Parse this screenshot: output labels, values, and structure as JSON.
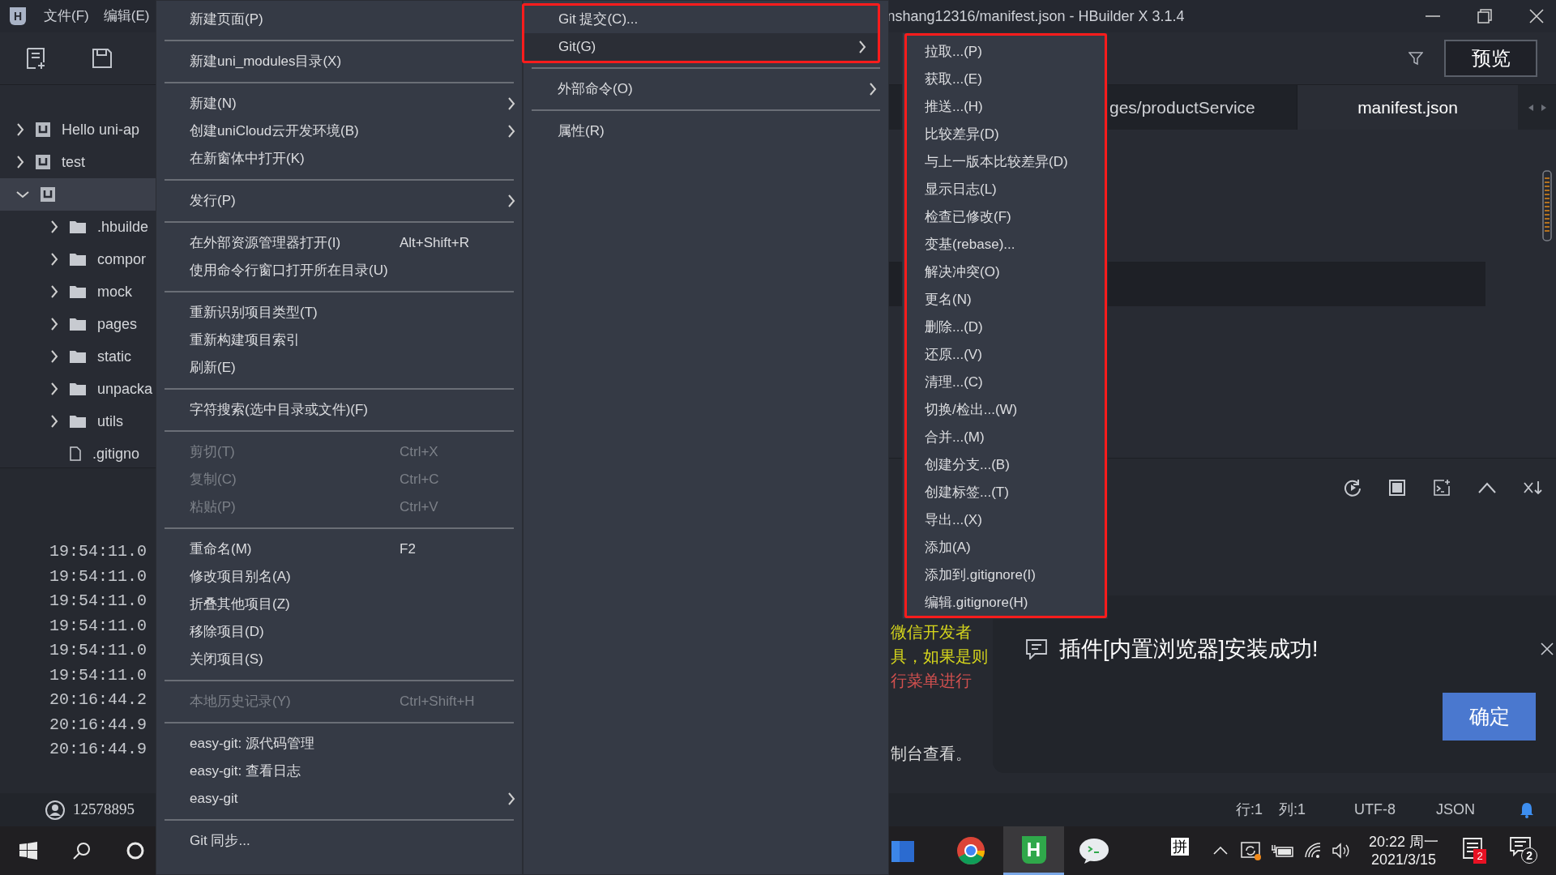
{
  "title_bar": {
    "logo": "H",
    "menus": [
      "文件(F)",
      "编辑(E)"
    ],
    "title": "nshang12316/manifest.json - HBuilder X 3.1.4"
  },
  "toolbar": {
    "preview_button": "预览"
  },
  "project_tree": [
    {
      "kind": "project",
      "label": "Hello uni-ap",
      "expanded": false,
      "selected": false
    },
    {
      "kind": "project",
      "label": "test",
      "expanded": false,
      "selected": false
    },
    {
      "kind": "project",
      "expanded": true,
      "selected": true,
      "children": [
        {
          "kind": "folder",
          "label": ".hbuilde"
        },
        {
          "kind": "folder",
          "label": "compor"
        },
        {
          "kind": "folder",
          "label": "mock"
        },
        {
          "kind": "folder",
          "label": "pages"
        },
        {
          "kind": "folder",
          "label": "static"
        },
        {
          "kind": "folder",
          "label": "unpacka"
        },
        {
          "kind": "folder",
          "label": "utils"
        },
        {
          "kind": "file",
          "label": ".gitigno"
        }
      ]
    }
  ],
  "console_times": [
    "19:54:11.0",
    "19:54:11.0",
    "19:54:11.0",
    "19:54:11.0",
    "19:54:11.0",
    "19:54:11.0",
    "20:16:44.2",
    "20:16:44.9",
    "20:16:44.9"
  ],
  "editor_tabs": [
    {
      "label": "ges/productService",
      "selected": false
    },
    {
      "label": "manifest.json",
      "selected": true
    }
  ],
  "console_lines": [
    {
      "text": "微信开发者",
      "color": "#d6d61c"
    },
    {
      "text": "具，如果是则",
      "color": "#d6d61c"
    },
    {
      "text": "行菜单进行",
      "color": "#d2504f"
    },
    {
      "text": "制台查看。",
      "color": "#dcdcdc"
    }
  ],
  "notification": {
    "message": "插件[内置浏览器]安装成功!",
    "button": "确定"
  },
  "status_bar": {
    "user": "12578895",
    "line": "行:1",
    "column": "列:1",
    "encoding": "UTF-8",
    "language": "JSON"
  },
  "taskbar": {
    "app_letter": "H",
    "ime": "拼",
    "time": "20:22 周一",
    "date": "2021/3/15",
    "notification_badge": "2",
    "action_badge": "2"
  },
  "context_menu": [
    {
      "kind": "item",
      "label": "新建页面(P)",
      "disabled": false,
      "submenu": false
    },
    {
      "kind": "separator"
    },
    {
      "kind": "item",
      "label": "新建uni_modules目录(X)",
      "disabled": false,
      "submenu": false
    },
    {
      "kind": "separator"
    },
    {
      "kind": "item",
      "label": "新建(N)",
      "disabled": false,
      "submenu": true
    },
    {
      "kind": "item",
      "label": "创建uniCloud云开发环境(B)",
      "disabled": false,
      "submenu": true
    },
    {
      "kind": "item",
      "label": "在新窗体中打开(K)",
      "disabled": false,
      "submenu": false
    },
    {
      "kind": "separator"
    },
    {
      "kind": "item",
      "label": "发行(P)",
      "disabled": false,
      "submenu": true
    },
    {
      "kind": "separator"
    },
    {
      "kind": "item",
      "label": "在外部资源管理器打开(I)",
      "shortcut": "Alt+Shift+R",
      "disabled": false,
      "submenu": false
    },
    {
      "kind": "item",
      "label": "使用命令行窗口打开所在目录(U)",
      "disabled": false,
      "submenu": false
    },
    {
      "kind": "separator"
    },
    {
      "kind": "item",
      "label": "重新识别项目类型(T)",
      "disabled": false,
      "submenu": false
    },
    {
      "kind": "item",
      "label": "重新构建项目索引",
      "disabled": false,
      "submenu": false
    },
    {
      "kind": "item",
      "label": "刷新(E)",
      "disabled": false,
      "submenu": false
    },
    {
      "kind": "separator"
    },
    {
      "kind": "item",
      "label": "字符搜索(选中目录或文件)(F)",
      "disabled": false,
      "submenu": false
    },
    {
      "kind": "separator"
    },
    {
      "kind": "item",
      "label": "剪切(T)",
      "shortcut": "Ctrl+X",
      "disabled": true,
      "submenu": false
    },
    {
      "kind": "item",
      "label": "复制(C)",
      "shortcut": "Ctrl+C",
      "disabled": true,
      "submenu": false
    },
    {
      "kind": "item",
      "label": "粘贴(P)",
      "shortcut": "Ctrl+V",
      "disabled": true,
      "submenu": false
    },
    {
      "kind": "separator"
    },
    {
      "kind": "item",
      "label": "重命名(M)",
      "shortcut": "F2",
      "disabled": false,
      "submenu": false
    },
    {
      "kind": "item",
      "label": "修改项目别名(A)",
      "disabled": false,
      "submenu": false
    },
    {
      "kind": "item",
      "label": "折叠其他项目(Z)",
      "disabled": false,
      "submenu": false
    },
    {
      "kind": "item",
      "label": "移除项目(D)",
      "disabled": false,
      "submenu": false
    },
    {
      "kind": "item",
      "label": "关闭项目(S)",
      "disabled": false,
      "submenu": false
    },
    {
      "kind": "separator"
    },
    {
      "kind": "item",
      "label": "本地历史记录(Y)",
      "shortcut": "Ctrl+Shift+H",
      "disabled": true,
      "submenu": false
    },
    {
      "kind": "separator"
    },
    {
      "kind": "item",
      "label": "easy-git: 源代码管理",
      "disabled": false,
      "submenu": false
    },
    {
      "kind": "item",
      "label": "easy-git: 查看日志",
      "disabled": false,
      "submenu": false
    },
    {
      "kind": "item",
      "label": "easy-git",
      "disabled": false,
      "submenu": true
    },
    {
      "kind": "separator"
    },
    {
      "kind": "item",
      "label": "Git 同步...",
      "disabled": false,
      "submenu": false
    }
  ],
  "external_menu": [
    {
      "kind": "item",
      "label": "Git 提交(C)...",
      "selected": false,
      "submenu": false,
      "annotated": true
    },
    {
      "kind": "item",
      "label": "Git(G)",
      "selected": true,
      "submenu": true,
      "annotated": true
    },
    {
      "kind": "separator"
    },
    {
      "kind": "item",
      "label": "外部命令(O)",
      "selected": false,
      "submenu": true,
      "annotated": false
    },
    {
      "kind": "separator"
    },
    {
      "kind": "item",
      "label": "属性(R)",
      "selected": false,
      "submenu": false,
      "annotated": false
    }
  ],
  "git_menu": {
    "annotated": true,
    "items": [
      "拉取...(P)",
      "获取...(E)",
      "推送...(H)",
      "比较差异(D)",
      "与上一版本比较差异(D)",
      "显示日志(L)",
      "检查已修改(F)",
      "变基(rebase)...",
      "解决冲突(O)",
      "更名(N)",
      "删除...(D)",
      "还原...(V)",
      "清理...(C)",
      "切换/检出...(W)",
      "合并...(M)",
      "创建分支...(B)",
      "创建标签...(T)",
      "导出...(X)",
      "添加(A)",
      "添加到.gitignore(I)",
      "编辑.gitignore(H)"
    ]
  }
}
